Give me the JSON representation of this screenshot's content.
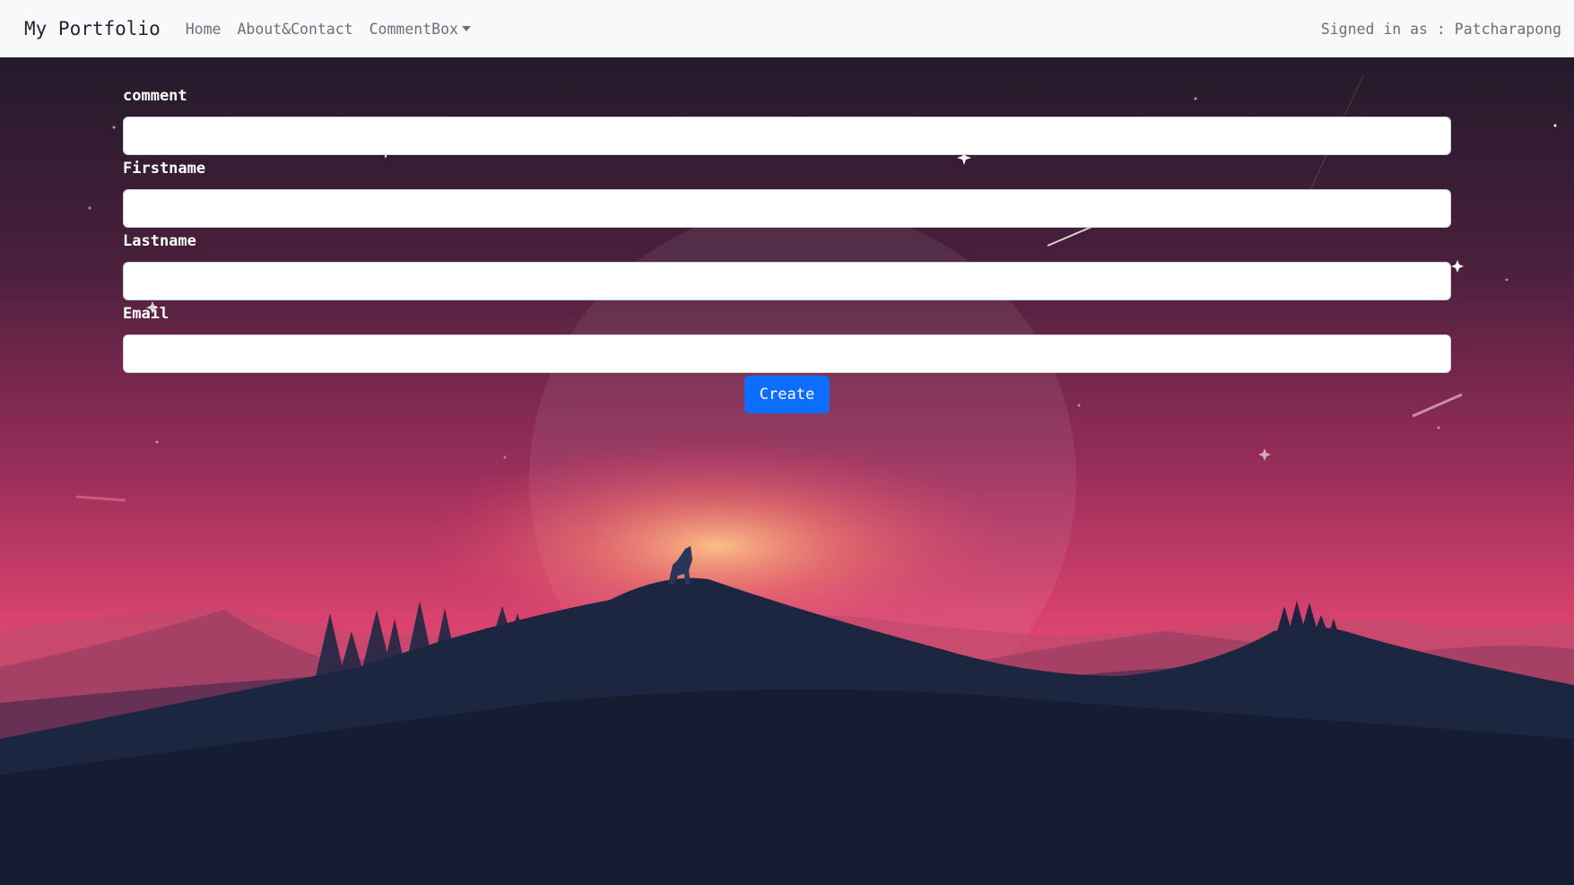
{
  "navbar": {
    "brand": "My Portfolio",
    "links": [
      "Home",
      "About&Contact",
      "CommentBox"
    ],
    "signed_in": "Signed in as : Patcharapong"
  },
  "form": {
    "fields": [
      {
        "label": "comment",
        "value": ""
      },
      {
        "label": "Firstname",
        "value": ""
      },
      {
        "label": "Lastname",
        "value": ""
      },
      {
        "label": "Email",
        "value": ""
      }
    ],
    "submit_label": "Create"
  },
  "colors": {
    "navbar_bg": "#f8f9fa",
    "button": "#0d6efd",
    "sky_top": "#2a1a2d",
    "sky_bottom": "#e0406e",
    "ground": "#141c31"
  },
  "icons": {
    "dropdown": "caret-down-icon"
  }
}
